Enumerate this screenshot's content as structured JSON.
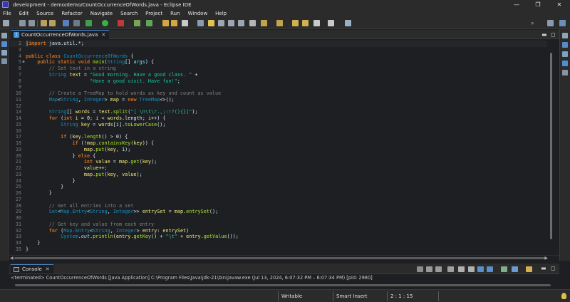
{
  "window": {
    "title": "development - demo/demo/CountOccurrenceOfWords.java - Eclipse IDE",
    "minimize": "—",
    "maximize": "❐",
    "close": "✕"
  },
  "menu": [
    "File",
    "Edit",
    "Source",
    "Refactor",
    "Navigate",
    "Search",
    "Project",
    "Run",
    "Window",
    "Help"
  ],
  "editor_tab": {
    "label": "CountOccurrenceOfWords.java",
    "close": "✕"
  },
  "code": [
    {
      "n": "2",
      "fold": "",
      "html": "<span class=\"caret\">|</span><span class=\"k\">import</span> java.util.*;"
    },
    {
      "n": "3",
      "fold": "",
      "html": ""
    },
    {
      "n": "4",
      "fold": "",
      "html": "<span class=\"k\">public class</span> <span class=\"t\">CountOccurrenceOfWords</span> {"
    },
    {
      "n": "5",
      "fold": "●",
      "html": "    <span class=\"k\">public static void</span> <span class=\"f\">main</span>(<span class=\"t\">String</span>[] <span class=\"p\">args</span>) {"
    },
    {
      "n": "6",
      "fold": "",
      "html": "        <span class=\"c\">// Set text in a string</span>"
    },
    {
      "n": "7",
      "fold": "",
      "html": "        <span class=\"t\">String</span> <span class=\"v\">text</span> = <span class=\"s\">\"Good morning. Have a good class. \"</span> +"
    },
    {
      "n": "8",
      "fold": "",
      "html": "                      <span class=\"s\">\"Have a good visit. Have fun!\"</span>;"
    },
    {
      "n": "9",
      "fold": "",
      "html": ""
    },
    {
      "n": "10",
      "fold": "",
      "html": "        <span class=\"c\">// Create a TreeMap to hold words as key and count as value</span>"
    },
    {
      "n": "11",
      "fold": "",
      "html": "        <span class=\"t\">Map</span>&lt;<span class=\"t\">String</span>, <span class=\"t\">Integer</span>&gt; <span class=\"v\">map</span> = <span class=\"k\">new</span> <span class=\"t\">TreeMap</span>&lt;&gt;();"
    },
    {
      "n": "12",
      "fold": "",
      "html": ""
    },
    {
      "n": "13",
      "fold": "",
      "html": "        <span class=\"t\">String</span>[] <span class=\"v\">words</span> = <span class=\"v\">text</span>.<span class=\"f\">split</span>(<span class=\"s\">\"[ \\n\\t\\r.,;:!?(){}]\"</span>);"
    },
    {
      "n": "14",
      "fold": "",
      "html": "        <span class=\"k\">for</span> (<span class=\"k\">int</span> <span class=\"v\">i</span> = 0; <span class=\"v\">i</span> &lt; <span class=\"v\">words</span>.length; <span class=\"v\">i</span>++) {"
    },
    {
      "n": "15",
      "fold": "",
      "html": "            <span class=\"t\">String</span> <span class=\"v\">key</span> = <span class=\"v\">words</span>[<span class=\"v\">i</span>].<span class=\"f\">toLowerCase</span>();"
    },
    {
      "n": "16",
      "fold": "",
      "html": ""
    },
    {
      "n": "17",
      "fold": "",
      "html": "            <span class=\"k\">if</span> (<span class=\"v\">key</span>.<span class=\"f\">length</span>() &gt; 0) {"
    },
    {
      "n": "18",
      "fold": "",
      "html": "                <span class=\"k\">if</span> (!<span class=\"v\">map</span>.<span class=\"f\">containsKey</span>(<span class=\"v\">key</span>)) {"
    },
    {
      "n": "19",
      "fold": "",
      "html": "                    <span class=\"v\">map</span>.<span class=\"f\">put</span>(<span class=\"v\">key</span>, 1);"
    },
    {
      "n": "20",
      "fold": "",
      "html": "                } <span class=\"k\">else</span> {"
    },
    {
      "n": "21",
      "fold": "",
      "html": "                    <span class=\"k\">int</span> <span class=\"v\">value</span> = <span class=\"v\">map</span>.<span class=\"f\">get</span>(<span class=\"v\">key</span>);"
    },
    {
      "n": "22",
      "fold": "",
      "html": "                    <span class=\"v\">value</span>++;"
    },
    {
      "n": "23",
      "fold": "",
      "html": "                    <span class=\"v\">map</span>.<span class=\"f\">put</span>(<span class=\"v\">key</span>, <span class=\"v\">value</span>);"
    },
    {
      "n": "24",
      "fold": "",
      "html": "                }"
    },
    {
      "n": "25",
      "fold": "",
      "html": "            }"
    },
    {
      "n": "26",
      "fold": "",
      "html": "        }"
    },
    {
      "n": "27",
      "fold": "",
      "html": ""
    },
    {
      "n": "28",
      "fold": "",
      "html": "        <span class=\"c\">// Get all entries into a set</span>"
    },
    {
      "n": "29",
      "fold": "",
      "html": "        <span class=\"t\">Set</span>&lt;<span class=\"t\">Map.Entry</span>&lt;<span class=\"t\">String</span>, <span class=\"t\">Integer</span>&gt;&gt; <span class=\"v\">entrySet</span> = <span class=\"v\">map</span>.<span class=\"f\">entrySet</span>();"
    },
    {
      "n": "30",
      "fold": "",
      "html": ""
    },
    {
      "n": "31",
      "fold": "",
      "html": "        <span class=\"c\">// Get key and value from each entry</span>"
    },
    {
      "n": "32",
      "fold": "",
      "html": "        <span class=\"k\">for</span> (<span class=\"t\">Map.Entry</span>&lt;<span class=\"t\">String</span>, <span class=\"t\">Integer</span>&gt; <span class=\"v\">entry</span>: <span class=\"v\">entrySet</span>)"
    },
    {
      "n": "33",
      "fold": "",
      "html": "            <span class=\"t\">System</span>.<span class=\"st\">out</span>.<span class=\"f\">println</span>(<span class=\"v\">entry</span>.<span class=\"f\">getKey</span>() + <span class=\"s\">\"\\t\"</span> + <span class=\"v\">entry</span>.<span class=\"f\">getValue</span>());"
    },
    {
      "n": "34",
      "fold": "",
      "html": "    }"
    },
    {
      "n": "35",
      "fold": "",
      "html": "}"
    }
  ],
  "console": {
    "tab_label": "Console",
    "close": "✕",
    "terminated_text": "<terminated> CountOccurrenceOfWords [Java Application] C:\\Program Files\\Java\\jdk-21\\bin\\javaw.exe  (Jul 13, 2024, 6:07:32 PM – 6:07:34 PM) [pid: 2980]"
  },
  "status": {
    "writable": "Writable",
    "insert_mode": "Smart Insert",
    "position": "2 : 1 : 15"
  },
  "colors": {
    "keyword": "#cc6c1d",
    "type": "#1290c3",
    "string": "#17c6a3",
    "comment": "#808080",
    "method": "#a7ec21",
    "variable": "#f3ec79",
    "parameter": "#66e1f8"
  },
  "icons": [
    "eclipse-icon",
    "java-file-icon",
    "console-icon",
    "search-icon",
    "close-icon",
    "minimize-icon",
    "maximize-icon",
    "lightbulb-icon"
  ]
}
